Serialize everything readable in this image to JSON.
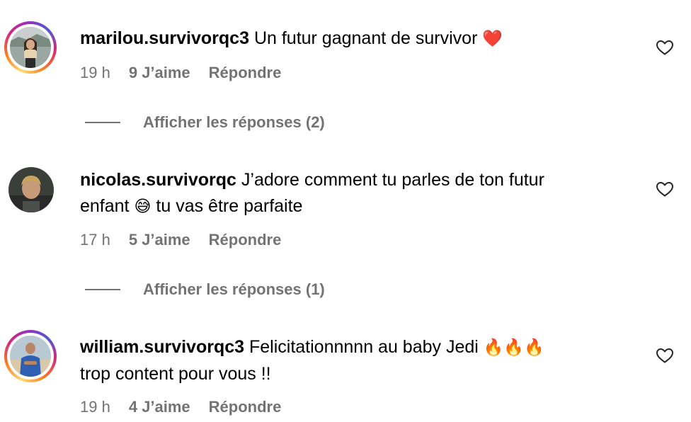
{
  "comments": [
    {
      "username": "marilou.survivorqc3",
      "text_parts": [
        "Un futur gagnant de survivor",
        "❤️"
      ],
      "time": "19 h",
      "likes": "9 J’aime",
      "reply": "Répondre",
      "view_replies": "Afficher les réponses (2)",
      "avatar_icon": "avatar-woman",
      "has_story_ring": true
    },
    {
      "username": "nicolas.survivorqc",
      "text_line1": "J’adore comment tu parles de ton futur",
      "text_line2_start": "enfant",
      "text_emoji": "😅",
      "text_line2_end": "tu vas être parfaite",
      "time": "17 h",
      "likes": "5 J’aime",
      "reply": "Répondre",
      "view_replies": "Afficher les réponses (1)",
      "avatar_icon": "avatar-man",
      "has_story_ring": false
    },
    {
      "username": "william.survivorqc3",
      "text_line1": "Felicitationnnnn au baby Jedi",
      "text_emoji": "🔥🔥🔥",
      "text_line2": "trop content pour vous !!",
      "time": "19 h",
      "likes": "4 J’aime",
      "reply": "Répondre",
      "avatar_icon": "avatar-man-blue-shirt",
      "has_story_ring": true
    }
  ],
  "colors": {
    "meta_text": "#737373",
    "heart_emoji": "#e0245e",
    "story_ring": "#d62976"
  },
  "icons": {
    "like": "heart-outline-icon"
  }
}
